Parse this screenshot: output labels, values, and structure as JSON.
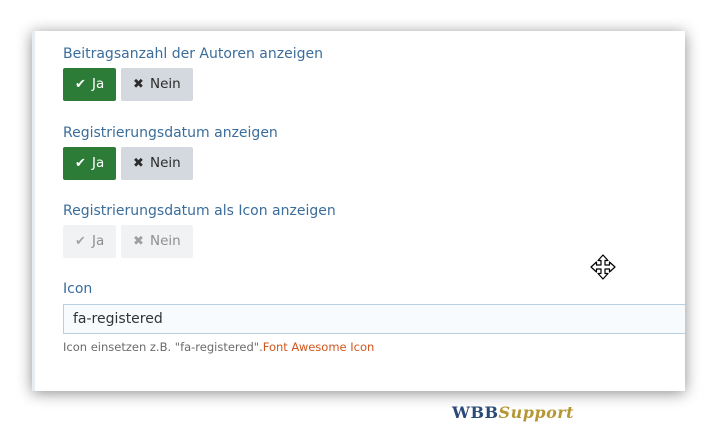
{
  "settings": {
    "author_count": {
      "label": "Beitragsanzahl der Autoren anzeigen",
      "yes_label": "Ja",
      "no_label": "Nein",
      "selected": "Ja"
    },
    "reg_date": {
      "label": "Registrierungsdatum anzeigen",
      "yes_label": "Ja",
      "no_label": "Nein",
      "selected": "Ja"
    },
    "reg_date_icon": {
      "label": "Registrierungsdatum als Icon anzeigen",
      "yes_label": "Ja",
      "no_label": "Nein",
      "state": "disabled"
    },
    "icon": {
      "label": "Icon",
      "value": "fa-registered",
      "help_text": "Icon einsetzen z.B. \"fa-registered\".",
      "help_link": "Font Awesome Icon"
    }
  },
  "icons": {
    "yes": "check-icon",
    "no": "times-icon",
    "cursor": "move-cursor-icon"
  },
  "colors": {
    "label": "#3a6d9c",
    "yes_active": "#2c7c38",
    "no_button": "#d3d9de",
    "link": "#d0561c"
  },
  "watermark": {
    "text_main": "WBB",
    "text_accent": "Support"
  }
}
